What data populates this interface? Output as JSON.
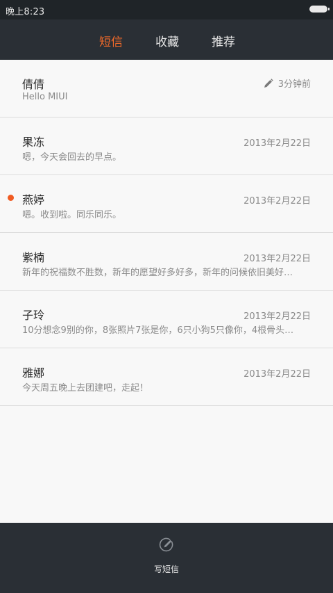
{
  "status_bar": {
    "time": "晚上8:23"
  },
  "tabs": [
    {
      "label": "短信",
      "active": true
    },
    {
      "label": "收藏",
      "active": false
    },
    {
      "label": "推荐",
      "active": false
    }
  ],
  "conversations": [
    {
      "name": "倩倩",
      "preview": "Hello MIUI",
      "time": "3分钟前",
      "draft": true,
      "unread": false
    },
    {
      "name": "果冻",
      "preview": "嗯，今天会回去的早点。",
      "time": "2013年2月22日",
      "draft": false,
      "unread": false
    },
    {
      "name": "燕婷",
      "preview": "嗯。收到啦。同乐同乐。",
      "time": "2013年2月22日",
      "draft": false,
      "unread": true
    },
    {
      "name": "紫楠",
      "preview": "新年的祝福数不胜数，新年的愿望好多好多，新年的问候依旧美好…",
      "time": "2013年2月22日",
      "draft": false,
      "unread": false
    },
    {
      "name": "子玲",
      "preview": "10分想念9别的你，8张照片7张是你，6只小狗5只像你，4根骨头…",
      "time": "2013年2月22日",
      "draft": false,
      "unread": false
    },
    {
      "name": "雅娜",
      "preview": "今天周五晚上去团建吧，走起！",
      "time": "2013年2月22日",
      "draft": false,
      "unread": false
    }
  ],
  "bottom_bar": {
    "compose_label": "写短信"
  },
  "icons": {
    "draft": "pencil-icon",
    "compose": "compose-icon"
  },
  "colors": {
    "accent": "#f06a2a",
    "unread_dot": "#f05b22",
    "header_bg": "#2a2f35",
    "list_bg": "#f8f8f8"
  }
}
